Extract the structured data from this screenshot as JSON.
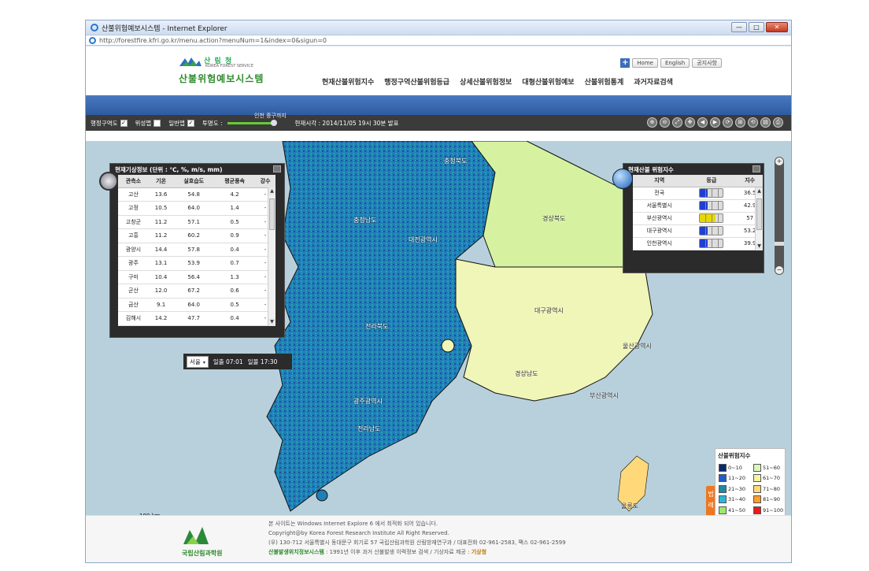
{
  "window": {
    "title": "산불위험예보시스템 - Internet Explorer",
    "url": "http://forestfire.kfri.go.kr/menu.action?menuNum=1&index=0&sigun=0",
    "min": "—",
    "max": "□",
    "close": "✕"
  },
  "header": {
    "forest_logo": "산 림 청",
    "forest_logo_sub": "KOREA FOREST SERVICE",
    "site_title": "산불위험예보시스템",
    "toplinks": [
      "Home",
      "English",
      "공지사항"
    ],
    "plus": "+",
    "gnb": [
      "현재산불위험지수",
      "행정구역산불위험등급",
      "상세산불위험정보",
      "대형산불위험예보",
      "산불위험통계",
      "과거자료검색"
    ]
  },
  "toolbar": {
    "admin": "행정구역도",
    "satellite": "위성맵",
    "general": "일반맵",
    "opacity": "투명도 :",
    "check": "✓",
    "slider_label": "인천 중구까지",
    "date": "현재시각 : 2014/11/05 19시 30분 발표",
    "tools": [
      "⊕",
      "⊖",
      "⤢",
      "✥",
      "◀",
      "▶",
      "⟳",
      "⊞",
      "⟲",
      "▤",
      "⎙"
    ]
  },
  "weather": {
    "title": "현재기상정보 (단위 : ℃, %, m/s, mm)",
    "columns": [
      "관측소",
      "기온",
      "실효습도",
      "평균풍속",
      "강수"
    ],
    "rows": [
      [
        "고산",
        "13.6",
        "54.8",
        "4.2",
        "-"
      ],
      [
        "고정",
        "10.5",
        "64.0",
        "1.4",
        "-"
      ],
      [
        "고창군",
        "11.2",
        "57.1",
        "0.5",
        "-"
      ],
      [
        "고흥",
        "11.2",
        "60.2",
        "0.9",
        "-"
      ],
      [
        "광양시",
        "14.4",
        "57.8",
        "0.4",
        "-"
      ],
      [
        "광주",
        "13.1",
        "53.9",
        "0.7",
        "-"
      ],
      [
        "구미",
        "10.4",
        "56.4",
        "1.3",
        "-"
      ],
      [
        "군산",
        "12.0",
        "67.2",
        "0.6",
        "-"
      ],
      [
        "금산",
        "9.1",
        "64.0",
        "0.5",
        "-"
      ],
      [
        "김해시",
        "14.2",
        "47.7",
        "0.4",
        "-"
      ]
    ],
    "city": "서울",
    "sunrise": "일출 07:01",
    "sunset": "일몰 17:30"
  },
  "risk": {
    "title": "현재산불 위험지수",
    "columns": [
      "지역",
      "등급",
      "지수"
    ],
    "rows": [
      {
        "region": "전국",
        "index": "36.5",
        "level": 0.33,
        "color": "#1f3fd0"
      },
      {
        "region": "서울특별시",
        "index": "42.9",
        "level": 0.33,
        "color": "#1f3fd0"
      },
      {
        "region": "부산광역시",
        "index": "57",
        "level": 0.66,
        "color": "#e8d800"
      },
      {
        "region": "대구광역시",
        "index": "53.2",
        "level": 0.33,
        "color": "#1f3fd0"
      },
      {
        "region": "인천광역시",
        "index": "39.9",
        "level": 0.33,
        "color": "#1f3fd0"
      }
    ]
  },
  "map": {
    "labels": [
      {
        "text": "충청북도",
        "dark": false
      },
      {
        "text": "충청남도",
        "dark": false
      },
      {
        "text": "경상북도",
        "dark": true
      },
      {
        "text": "대전광역시",
        "dark": false
      },
      {
        "text": "대구광역시",
        "dark": true
      },
      {
        "text": "전라북도",
        "dark": false
      },
      {
        "text": "울산광역시",
        "dark": true
      },
      {
        "text": "경상남도",
        "dark": true
      },
      {
        "text": "광주광역시",
        "dark": false
      },
      {
        "text": "부산광역시",
        "dark": true
      },
      {
        "text": "전라남도",
        "dark": false
      },
      {
        "text": "울릉도",
        "dark": true
      }
    ],
    "scale": "100 km",
    "colors": {
      "deep": "#1d4f9c",
      "mid": "#1f7fb8",
      "teal": "#2aa0a8",
      "lime": "#d6f2a0",
      "yellow": "#f0f5b8",
      "sea": "#b8d0db"
    }
  },
  "legend": {
    "title": "산불위험지수",
    "tab": "범 례",
    "items": [
      {
        "label": "0~10",
        "color": "#0a2a6e"
      },
      {
        "label": "51~60",
        "color": "#d8f7b8"
      },
      {
        "label": "11~20",
        "color": "#1f5ec8"
      },
      {
        "label": "61~70",
        "color": "#f5f5a0"
      },
      {
        "label": "21~30",
        "color": "#1f8aa0"
      },
      {
        "label": "71~80",
        "color": "#ffd87a"
      },
      {
        "label": "31~40",
        "color": "#2fb6d8"
      },
      {
        "label": "81~90",
        "color": "#ff9c2a"
      },
      {
        "label": "41~50",
        "color": "#9ee86a"
      },
      {
        "label": "91~100",
        "color": "#e81a1a"
      }
    ]
  },
  "footer": {
    "logo": "국립산림과학원",
    "lines": [
      "본 사이트는 Windows Internet Explore 6 에서 최적화 되어 있습니다.",
      "Copyright@by Korea Forest Research Institute All Right Reserved.",
      "(우) 130-712 서울특별시 동대문구 회기로 57 국립산림과학원 산림방재연구과 / 대표전화 02-961-2583, 팩스 02-961-2599"
    ],
    "last_label": "산불발생위치정보시스템",
    "last_mid": " : 1991년 이후 과거 산불발생 이력정보 검색 / 기상자료 제공 : ",
    "last_hl": "기상청"
  }
}
